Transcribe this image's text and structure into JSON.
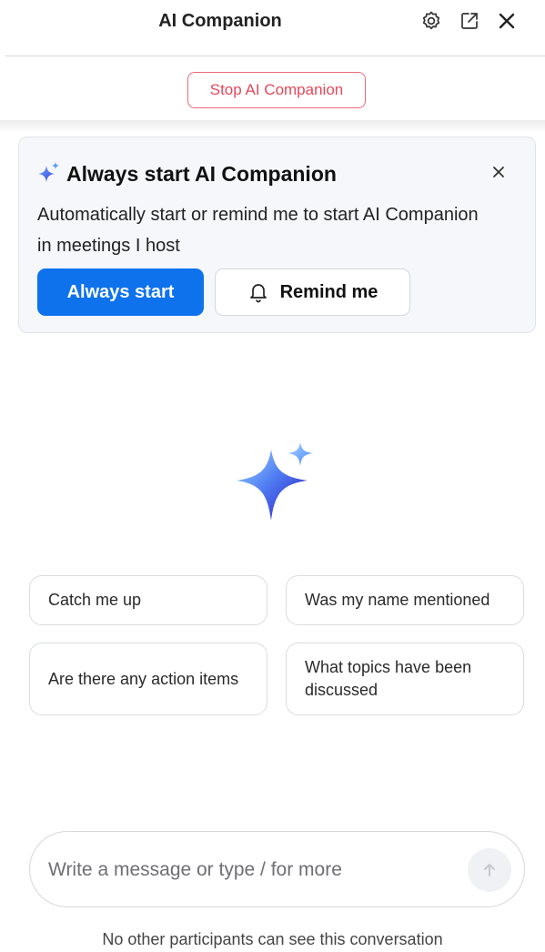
{
  "header": {
    "title": "AI Companion",
    "icons": [
      "gear-icon",
      "pop-out-icon",
      "close-icon"
    ]
  },
  "stop_button": {
    "label": "Stop AI Companion",
    "color": "#e5485a"
  },
  "banner": {
    "title": "Always start AI Companion",
    "description": "Automatically start or remind me to start AI Companion in meetings I host",
    "primary_label": "Always start",
    "secondary_label": "Remind me",
    "accent": "#0e72ed"
  },
  "suggestions": [
    "Catch me up",
    "Was my name mentioned",
    "Are there any action items",
    "What topics have been discussed"
  ],
  "composer": {
    "placeholder": "Write a message or type / for more",
    "value": ""
  },
  "footer": {
    "note": "No other participants can see this conversation"
  }
}
